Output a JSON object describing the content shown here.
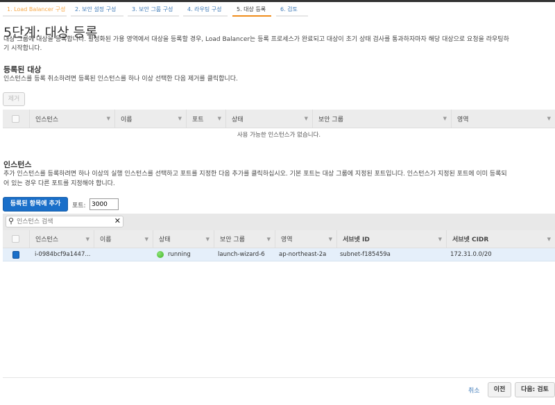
{
  "tabs": [
    {
      "label": "1. Load Balancer 구성"
    },
    {
      "label": "2. 보안 설정 구성"
    },
    {
      "label": "3. 보안 그룹 구성"
    },
    {
      "label": "4. 라우팅 구성"
    },
    {
      "label": "5. 대상 등록"
    },
    {
      "label": "6. 검토"
    }
  ],
  "page": {
    "title": "5단계: 대상 등록",
    "desc_line1": "대상 그룹에 대상을 등록합니다. 활성화된 가용 영역에서 대상을 등록할 경우, Load Balancer는 등록 프로세스가 완료되고 대상이 초기 상태 검사를 통과하자마자 해당 대상으로 요청을 라우팅하",
    "desc_line2": "기 시작합니다."
  },
  "registered": {
    "heading": "등록된 대상",
    "desc": "인스턴스를 등록 취소하려면 등록된 인스턴스를 하나 이상 선택한 다음 제거를 클릭합니다.",
    "remove_label": "제거",
    "columns": [
      "인스턴스",
      "이름",
      "포트",
      "상태",
      "보안 그룹",
      "영역"
    ],
    "empty_message": "사용 가능한 인스턴스가 없습니다."
  },
  "instances": {
    "heading": "인스턴스",
    "desc_line1": "추가 인스턴스를 등록하려면 하나 이상의 실행 인스턴스를 선택하고 포트를 지정한 다음 추가를 클릭하십시오. 기본 포트는 대상 그룹에 지정된 포트입니다. 인스턴스가 지정된 포트에 이미 등록되",
    "desc_line2": "어 있는 경우 다른 포트를 지정해야 합니다.",
    "add_label": "등록된 항목에 추가",
    "port_label": "포트:",
    "port_value": "3000",
    "search_placeholder": "인스턴스 검색",
    "columns": [
      "인스턴스",
      "이름",
      "상태",
      "보안 그룹",
      "영역",
      "서브넷 ID",
      "서브넷 CIDR"
    ],
    "rows": [
      {
        "instance": "i-0984bcf9a1447...",
        "name": "",
        "state": "running",
        "security_group": "launch-wizard-6",
        "zone": "ap-northeast-2a",
        "subnet_id": "subnet-f185459a",
        "subnet_cidr": "172.31.0.0/20",
        "selected": true
      }
    ]
  },
  "footer": {
    "cancel": "취소",
    "previous": "이전",
    "next": "다음: 검토"
  },
  "colors": {
    "accent": "#f08c1a",
    "primary": "#1a6fc9",
    "running": "#3cb521"
  }
}
